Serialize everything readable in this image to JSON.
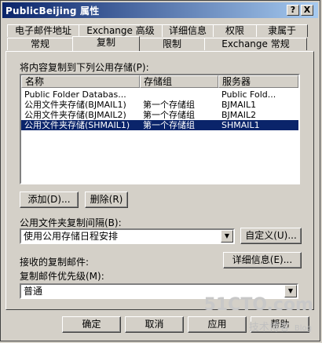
{
  "window": {
    "title": "PublicBeijing 属性"
  },
  "titlebar_buttons": {
    "help": "?",
    "close": "X"
  },
  "tabs_row1": [
    "电子邮件地址",
    "Exchange 高级",
    "详细信息",
    "权限",
    "隶属于"
  ],
  "tabs_row2": [
    "常规",
    "复制",
    "限制",
    "Exchange 常规"
  ],
  "active_tab": "复制",
  "replicate_list": {
    "label": "将内容复制到下列公用存储(P):",
    "columns": [
      "名称",
      "存储组",
      "服务器"
    ],
    "rows": [
      {
        "name": "Public Folder Databas...",
        "group": "",
        "server": "Public Fold..."
      },
      {
        "name": "公用文件夹存储(BJMAIL1)",
        "group": "第一个存储组",
        "server": "BJMAIL1"
      },
      {
        "name": "公用文件夹存储(BJMAIL2)",
        "group": "第一个存储组",
        "server": "BJMAIL2"
      },
      {
        "name": "公用文件夹存储(SHMAIL1)",
        "group": "第一个存储组",
        "server": "SHMAIL1",
        "selected": true
      }
    ]
  },
  "buttons": {
    "add": "添加(D)...",
    "remove": "删除(R)",
    "customize": "自定义(U)...",
    "details": "详细信息(E)...",
    "ok": "确定",
    "cancel": "取消",
    "apply": "应用",
    "help": "帮助"
  },
  "replication_interval": {
    "label": "公用文件夹复制间隔(B):",
    "value": "使用公用存储日程安排"
  },
  "received_label": "接收的复制邮件:",
  "priority": {
    "label": "复制邮件优先级(M):",
    "value": "普通"
  },
  "watermark": {
    "logo": "51CTO.com",
    "sub": "技术博客",
    "blog": "Blog"
  }
}
